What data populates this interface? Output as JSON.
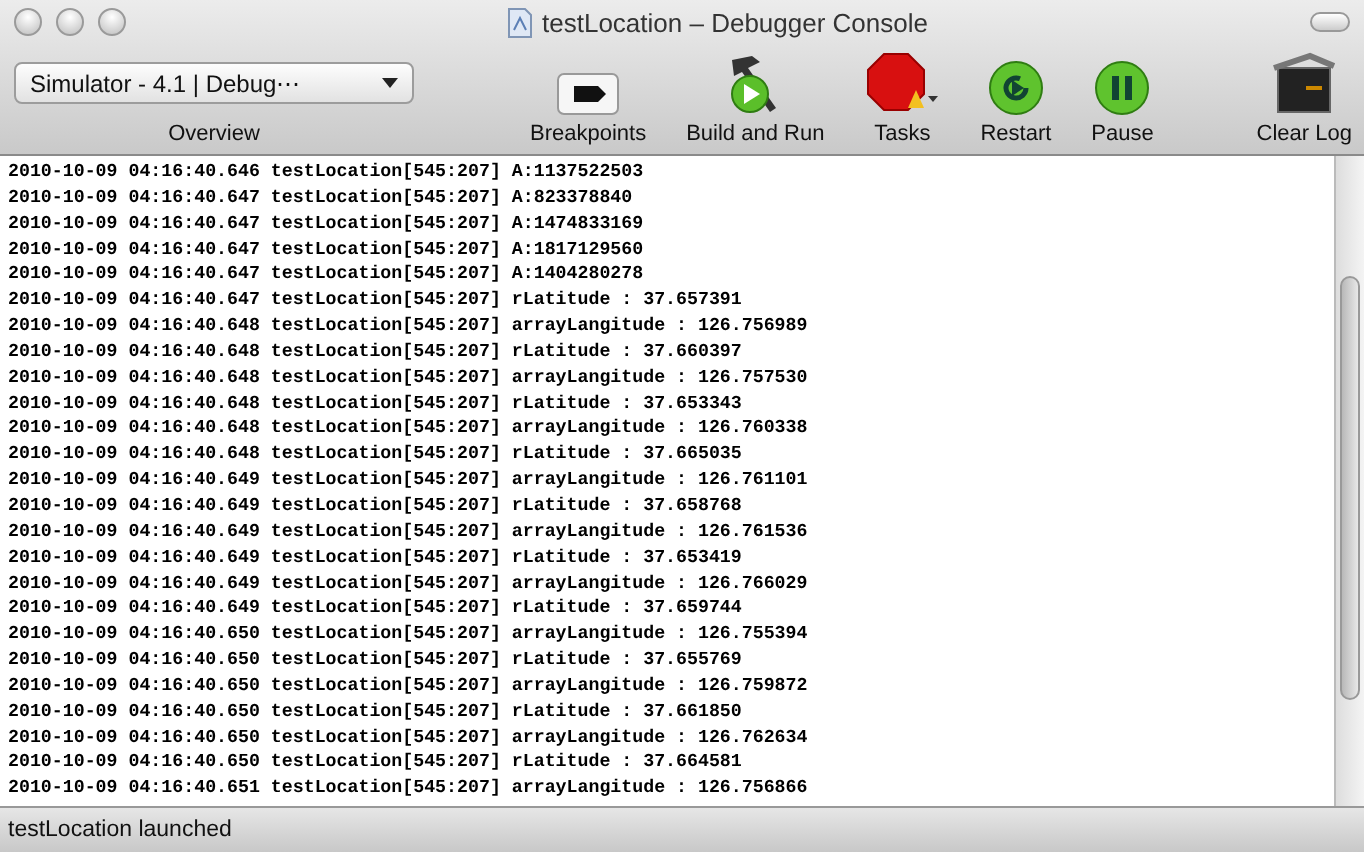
{
  "window": {
    "title": "testLocation – Debugger Console"
  },
  "toolbar": {
    "scheme": {
      "value": "Simulator - 4.1 | Debug⋯",
      "label": "Overview"
    },
    "buttons": [
      {
        "kind": "breakpoints",
        "label": "Breakpoints"
      },
      {
        "kind": "build",
        "label": "Build and Run"
      },
      {
        "kind": "tasks",
        "label": "Tasks"
      },
      {
        "kind": "restart",
        "label": "Restart"
      },
      {
        "kind": "pause",
        "label": "Pause"
      },
      {
        "kind": "clear",
        "label": "Clear Log"
      }
    ]
  },
  "console": {
    "lines": [
      "2010-10-09 04:16:40.646 testLocation[545:207] A:1137522503",
      "2010-10-09 04:16:40.647 testLocation[545:207] A:823378840",
      "2010-10-09 04:16:40.647 testLocation[545:207] A:1474833169",
      "2010-10-09 04:16:40.647 testLocation[545:207] A:1817129560",
      "2010-10-09 04:16:40.647 testLocation[545:207] A:1404280278",
      "2010-10-09 04:16:40.647 testLocation[545:207] rLatitude : 37.657391",
      "2010-10-09 04:16:40.648 testLocation[545:207] arrayLangitude : 126.756989",
      "2010-10-09 04:16:40.648 testLocation[545:207] rLatitude : 37.660397",
      "2010-10-09 04:16:40.648 testLocation[545:207] arrayLangitude : 126.757530",
      "2010-10-09 04:16:40.648 testLocation[545:207] rLatitude : 37.653343",
      "2010-10-09 04:16:40.648 testLocation[545:207] arrayLangitude : 126.760338",
      "2010-10-09 04:16:40.648 testLocation[545:207] rLatitude : 37.665035",
      "2010-10-09 04:16:40.649 testLocation[545:207] arrayLangitude : 126.761101",
      "2010-10-09 04:16:40.649 testLocation[545:207] rLatitude : 37.658768",
      "2010-10-09 04:16:40.649 testLocation[545:207] arrayLangitude : 126.761536",
      "2010-10-09 04:16:40.649 testLocation[545:207] rLatitude : 37.653419",
      "2010-10-09 04:16:40.649 testLocation[545:207] arrayLangitude : 126.766029",
      "2010-10-09 04:16:40.649 testLocation[545:207] rLatitude : 37.659744",
      "2010-10-09 04:16:40.650 testLocation[545:207] arrayLangitude : 126.755394",
      "2010-10-09 04:16:40.650 testLocation[545:207] rLatitude : 37.655769",
      "2010-10-09 04:16:40.650 testLocation[545:207] arrayLangitude : 126.759872",
      "2010-10-09 04:16:40.650 testLocation[545:207] rLatitude : 37.661850",
      "2010-10-09 04:16:40.650 testLocation[545:207] arrayLangitude : 126.762634",
      "2010-10-09 04:16:40.650 testLocation[545:207] rLatitude : 37.664581",
      "2010-10-09 04:16:40.651 testLocation[545:207] arrayLangitude : 126.756866"
    ]
  },
  "status_bar": "testLocation launched"
}
